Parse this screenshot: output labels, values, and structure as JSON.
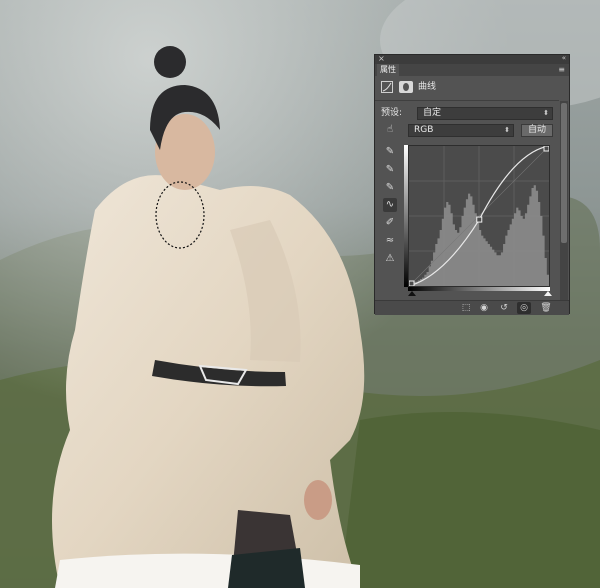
{
  "panel": {
    "tab_label": "属性",
    "adjustment_title": "曲线",
    "preset_label": "预设:",
    "preset_value": "自定",
    "channel_value": "RGB",
    "auto_button": "自动"
  },
  "curve": {
    "points": [
      [
        0,
        0
      ],
      [
        128,
        121
      ],
      [
        255,
        255
      ]
    ],
    "histogram": [
      2,
      2,
      3,
      3,
      4,
      5,
      6,
      8,
      10,
      14,
      18,
      24,
      30,
      34,
      40,
      48,
      56,
      60,
      58,
      52,
      44,
      40,
      38,
      42,
      50,
      56,
      62,
      66,
      64,
      58,
      52,
      46,
      40,
      36,
      34,
      32,
      30,
      28,
      26,
      24,
      22,
      22,
      24,
      30,
      36,
      40,
      44,
      48,
      52,
      56,
      54,
      50,
      48,
      52,
      58,
      64,
      70,
      72,
      68,
      60,
      50,
      36,
      20,
      8
    ]
  },
  "colors": {
    "panel_bg": "#535353",
    "curve_line": "#e8e8e8",
    "histogram": "#8c8c8c"
  }
}
